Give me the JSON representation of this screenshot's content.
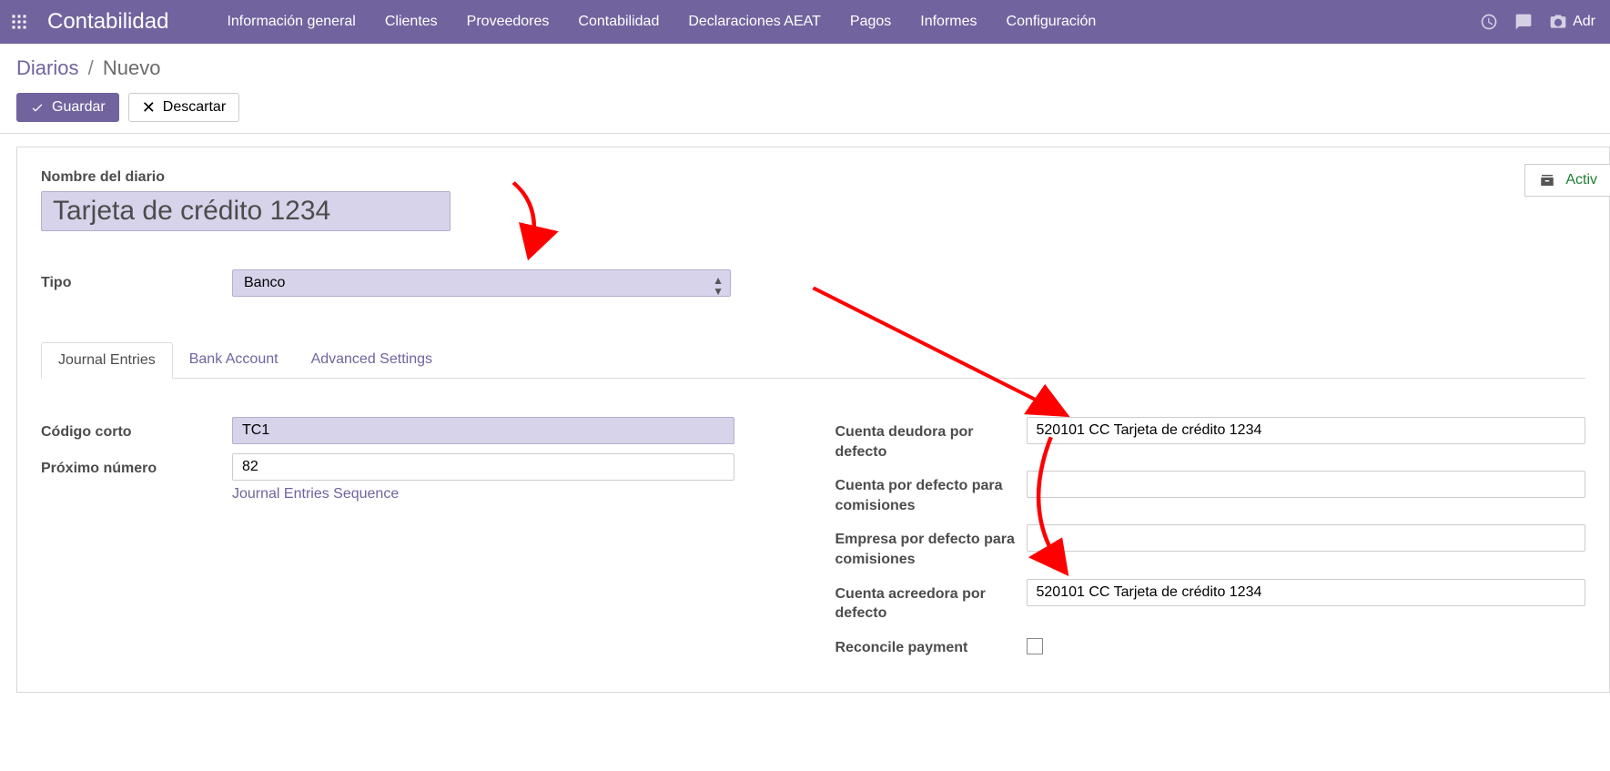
{
  "topbar": {
    "app_title": "Contabilidad",
    "nav": [
      "Información general",
      "Clientes",
      "Proveedores",
      "Contabilidad",
      "Declaraciones AEAT",
      "Pagos",
      "Informes",
      "Configuración"
    ],
    "admin_label": "Adr"
  },
  "breadcrumb": {
    "link": "Diarios",
    "current": "Nuevo"
  },
  "buttons": {
    "save": "Guardar",
    "discard": "Descartar",
    "active": "Activ"
  },
  "form": {
    "name_label": "Nombre del diario",
    "name_value": "Tarjeta de crédito 1234",
    "type_label": "Tipo",
    "type_value": "Banco"
  },
  "tabs": [
    "Journal Entries",
    "Bank Account",
    "Advanced Settings"
  ],
  "left": {
    "short_code_label": "Código corto",
    "short_code_value": "TC1",
    "next_num_label": "Próximo número",
    "next_num_value": "82",
    "seq_link": "Journal Entries Sequence"
  },
  "right": {
    "debit_label": "Cuenta deudora por defecto",
    "debit_value": "520101 CC Tarjeta de crédito 1234",
    "comm_acc_label": "Cuenta por defecto para comisiones",
    "comm_acc_value": "",
    "comm_partner_label": "Empresa por defecto para comisiones",
    "comm_partner_value": "",
    "credit_label": "Cuenta acreedora por defecto",
    "credit_value": "520101 CC Tarjeta de crédito 1234",
    "reconcile_label": "Reconcile payment"
  }
}
